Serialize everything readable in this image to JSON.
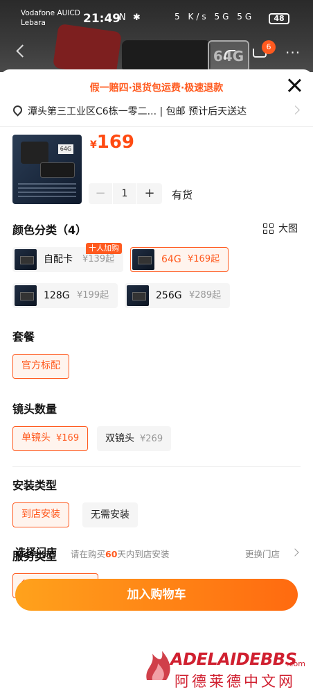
{
  "status_bar": {
    "carrier_line1": "Vodafone AUICD",
    "carrier_line2": "Lebara",
    "time": "21:49",
    "nfc_bt": "N ✱",
    "net_speed": "5 K/s",
    "signal": "5G 5G",
    "battery": "48"
  },
  "header": {
    "cart_count": "6",
    "hero_storage": "64G"
  },
  "sheet": {
    "banner": "假一赔四·退货包运费·极速退款",
    "address": "潭头第三工业区C6栋一零二... | 包邮  预计后天送达",
    "price_currency": "¥",
    "price_value": "169",
    "quantity": "1",
    "stock_label": "有货",
    "thumb_tag": "64G"
  },
  "color_section": {
    "title": "颜色分类（4）",
    "big_view_label": "大图",
    "badge": "十人加购",
    "options": [
      {
        "label": "自配卡",
        "price": "¥139起",
        "selected": false
      },
      {
        "label": "64G",
        "price": "¥169起",
        "selected": true
      },
      {
        "label": "128G",
        "price": "¥199起",
        "selected": false
      },
      {
        "label": "256G",
        "price": "¥289起",
        "selected": false
      }
    ]
  },
  "package_section": {
    "title": "套餐",
    "options": [
      {
        "label": "官方标配",
        "selected": true
      }
    ]
  },
  "lens_section": {
    "title": "镜头数量",
    "options": [
      {
        "label": "单镜头",
        "price": "¥169",
        "selected": true
      },
      {
        "label": "双镜头",
        "price": "¥269",
        "selected": false
      }
    ]
  },
  "install_section": {
    "title": "安装类型",
    "options": [
      {
        "label": "到店安装",
        "selected": true
      },
      {
        "label": "无需安装",
        "selected": false
      }
    ]
  },
  "service_section": {
    "title": "服务类型",
    "options": [
      {
        "label": "行车记录仪安装",
        "selected": true
      }
    ]
  },
  "store": {
    "title": "选择门店",
    "hint_prefix": "请在购买",
    "hint_days": "60",
    "hint_suffix": "天内到店安装",
    "change_label": "更换门店"
  },
  "cta": {
    "label": "加入购物车"
  },
  "watermark": {
    "brand": "ADELAIDEBBS",
    "domain_suffix": ".com",
    "chinese": "阿德莱德中文网"
  },
  "colors": {
    "accent": "#ff5a1f",
    "price": "#ff4b12",
    "watermark": "#d02030"
  }
}
